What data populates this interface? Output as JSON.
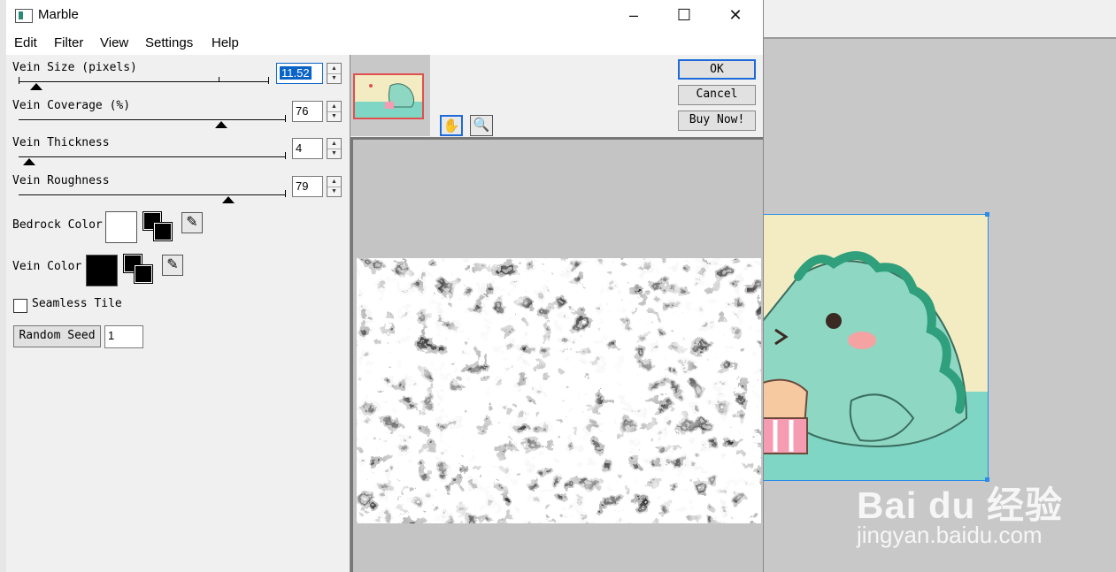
{
  "window": {
    "title": "Marble",
    "minimize": "–",
    "maximize": "☐",
    "close": "✕"
  },
  "menu": [
    "Edit",
    "Filter",
    "View",
    "Settings",
    "Help"
  ],
  "controls": {
    "vein_size": {
      "label": "Vein Size (pixels)",
      "value": "11.52"
    },
    "vein_coverage": {
      "label": "Vein Coverage (%)",
      "value": "76"
    },
    "vein_thickness": {
      "label": "Vein Thickness",
      "value": "4"
    },
    "vein_roughness": {
      "label": "Vein Roughness",
      "value": "79"
    },
    "bedrock_color": {
      "label": "Bedrock Color",
      "color": "#ffffff"
    },
    "vein_color": {
      "label": "Vein Color",
      "color": "#000000"
    },
    "seamless_tile": {
      "label": "Seamless Tile",
      "checked": false
    },
    "random_seed": {
      "button": "Random Seed",
      "value": "1"
    }
  },
  "buttons": {
    "ok": "OK",
    "cancel": "Cancel",
    "buy": "Buy Now!"
  },
  "tools": {
    "hand": "hand-icon",
    "zoom": "magnifier-icon"
  },
  "watermark": {
    "brand": "Bai du 经验",
    "url": "jingyan.baidu.com"
  }
}
